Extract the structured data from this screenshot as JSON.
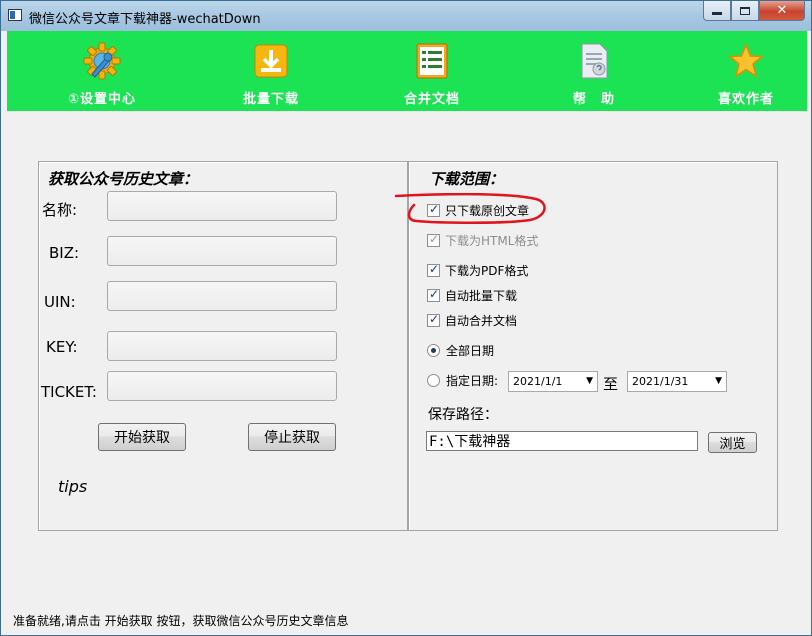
{
  "window": {
    "title": "微信公众号文章下载神器-wechatDown",
    "min_icon": "minimize-icon",
    "max_icon": "maximize-icon",
    "close_icon": "close-icon",
    "close_glyph": "✕"
  },
  "toolbar": {
    "background": "#1be354",
    "items": [
      {
        "label": "①设置中心",
        "icon": "settings-gear-wrench-icon"
      },
      {
        "label": "批量下载",
        "icon": "download-tray-icon"
      },
      {
        "label": "合并文档",
        "icon": "document-list-icon"
      },
      {
        "label": "帮　助",
        "icon": "help-document-icon"
      },
      {
        "label": "喜欢作者",
        "icon": "star-icon"
      }
    ]
  },
  "left_panel": {
    "title": "获取公众号历史文章：",
    "fields": [
      {
        "label": "名称:",
        "value": ""
      },
      {
        "label": "BIZ:",
        "value": ""
      },
      {
        "label": "UIN:",
        "value": ""
      },
      {
        "label": "KEY:",
        "value": ""
      },
      {
        "label": "TICKET:",
        "value": ""
      }
    ],
    "start_button": "开始获取",
    "stop_button": "停止获取",
    "tips": "tips"
  },
  "right_panel": {
    "title": "下载范围：",
    "options": [
      {
        "label": "只下载原创文章",
        "checked": true,
        "enabled": true
      },
      {
        "label": "下载为HTML格式",
        "checked": true,
        "enabled": false
      },
      {
        "label": "下载为PDF格式",
        "checked": true,
        "enabled": true
      },
      {
        "label": "自动批量下载",
        "checked": true,
        "enabled": true
      },
      {
        "label": "自动合并文档",
        "checked": true,
        "enabled": true
      }
    ],
    "radio_all_dates": "全部日期",
    "radio_specific_date": "指定日期:",
    "date_from": "2021/1/1",
    "date_to_label": "至",
    "date_to": "2021/1/31",
    "save_path_label": "保存路径：",
    "save_path_value": "F:\\下载神器",
    "browse_button": "浏览"
  },
  "status_text": "准备就绪,请点击 开始获取 按钮，获取微信公众号历史文章信息",
  "annotation_color": "#e0141c"
}
